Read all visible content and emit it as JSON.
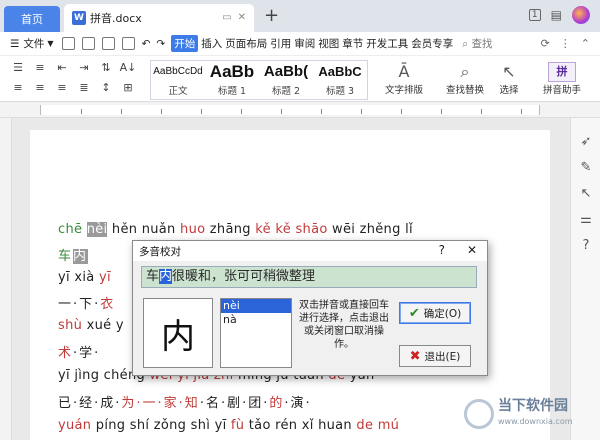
{
  "tabs": {
    "home": "首页",
    "doc": "拼音.docx",
    "new_tab": "+"
  },
  "titlebar": {
    "badge": "1"
  },
  "menu": {
    "file": "文件",
    "items": [
      "开始",
      "插入",
      "页面布局",
      "引用",
      "审阅",
      "视图",
      "章节",
      "开发工具",
      "会员专享"
    ],
    "active_index": 0,
    "search": "查找"
  },
  "ribbon": {
    "styles": [
      {
        "preview": "AaBbCcDd",
        "label": "正文"
      },
      {
        "preview": "AaBb",
        "label": "标题 1"
      },
      {
        "preview": "AaBb(",
        "label": "标题 2"
      },
      {
        "preview": "AaBbC",
        "label": "标题 3"
      }
    ],
    "text_layout": "文字排版",
    "find_replace": "查找替换",
    "select": "选择",
    "pinyin_helper": "拼音助手",
    "pinyin_icon": "拼"
  },
  "document": {
    "line1": {
      "a": "chē ",
      "b": "nèi",
      "c": " hěn nuǎn ",
      "d": "huo",
      "e": "  zhāng ",
      "f": "kě kě shāo",
      "g": " wēi zhěng lǐ"
    },
    "line2": {
      "a": "车",
      "b": "内"
    },
    "line3": {
      "a": "yī xià ",
      "b": "yī"
    },
    "line4": {
      "a": "一·下·",
      "b": "衣"
    },
    "line5": {
      "a": "shù",
      "b": " xué y"
    },
    "line6": {
      "a": "术",
      "b": "·学·"
    },
    "line7": {
      "a": "yī jìng chéng ",
      "b": "wéi yī jiā zhī",
      "c": " míng jù tuán ",
      "d": "de",
      "e": " yǎn"
    },
    "line8": {
      "a": "已·经·成·",
      "b": "为·一·家·知",
      "c": "·名·剧·团·",
      "d": "的",
      "e": "·演·"
    },
    "line9": {
      "a": "yuán",
      "b": "  píng shí zǒng shì yī ",
      "c": "fù",
      "d": " tǎo rén xǐ huan ",
      "e": "de mú"
    }
  },
  "dialog": {
    "title": "多音校对",
    "help": "?",
    "close": "✕",
    "sentence_before": "车",
    "sentence_sel": "内",
    "sentence_after": "很暖和，张可可稍微整理",
    "char": "内",
    "options": [
      "nèi",
      "nà"
    ],
    "selected_option": 0,
    "hint": "双击拼音或直接回车进行选择，点击退出或关闭窗口取消操作。",
    "ok": "确定(O)",
    "quit": "退出(E)"
  },
  "watermark": {
    "title": "当下软件园",
    "url": "www.downxia.com"
  }
}
